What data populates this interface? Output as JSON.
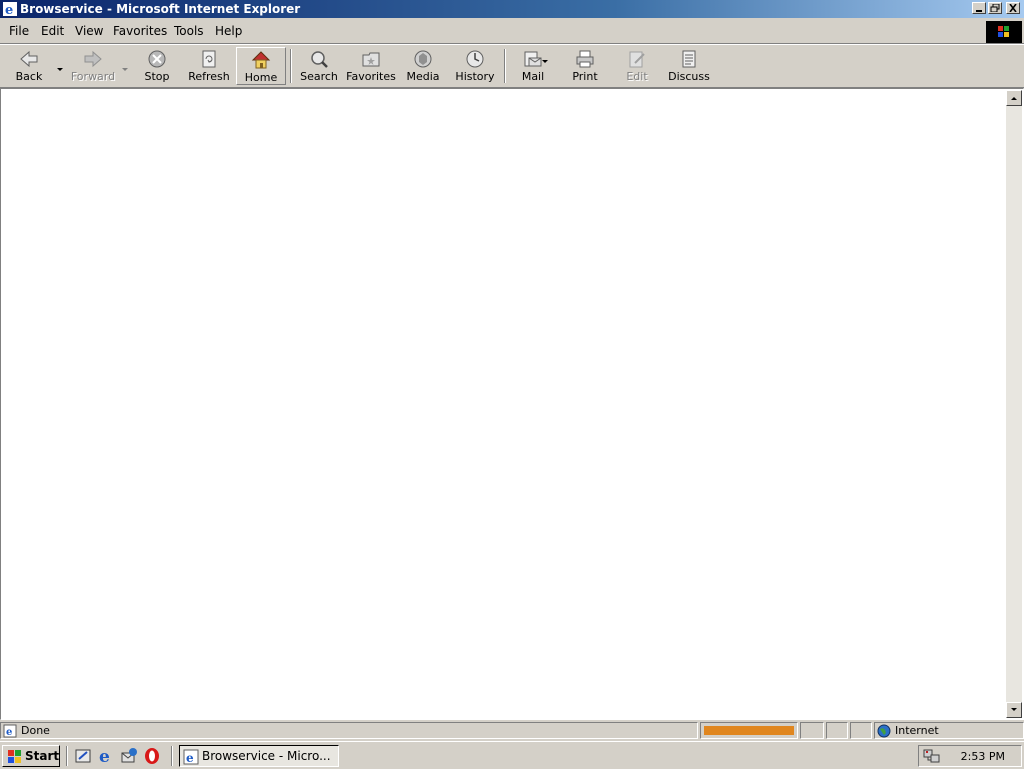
{
  "window": {
    "title": "Browservice - Microsoft Internet Explorer"
  },
  "menu": [
    {
      "label": "File"
    },
    {
      "label": "Edit"
    },
    {
      "label": "View"
    },
    {
      "label": "Favorites"
    },
    {
      "label": "Tools"
    },
    {
      "label": "Help"
    }
  ],
  "toolbar": {
    "back": "Back",
    "forward": "Forward",
    "stop": "Stop",
    "refresh": "Refresh",
    "home": "Home",
    "search": "Search",
    "favorites": "Favorites",
    "media": "Media",
    "history": "History",
    "mail": "Mail",
    "print": "Print",
    "edit": "Edit",
    "discuss": "Discuss"
  },
  "status": {
    "text": "Done",
    "zone": "Internet",
    "progress_fraction": 1.0,
    "progress_color": "#e0861e"
  },
  "taskbar": {
    "start": "Start",
    "task_label": "Browservice - Micro...",
    "clock": "2:53 PM"
  },
  "colors": {
    "titlebar_start": "#0a246a",
    "titlebar_end": "#a6caf0",
    "chrome": "#d4d0c8"
  }
}
